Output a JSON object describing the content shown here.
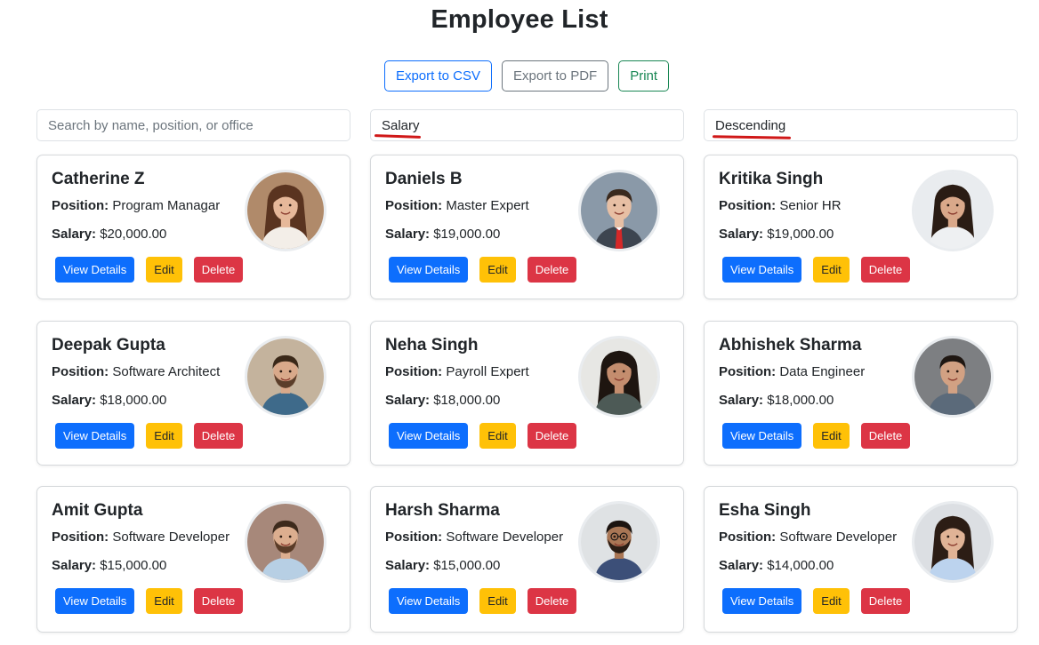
{
  "title": "Employee List",
  "export": {
    "csv_label": "Export to CSV",
    "pdf_label": "Export to PDF",
    "print_label": "Print"
  },
  "filters": {
    "search_placeholder": "Search by name, position, or office",
    "search_value": "",
    "sort_field": "Salary",
    "sort_order": "Descending"
  },
  "labels": {
    "position": "Position:",
    "salary": "Salary:",
    "view": "View Details",
    "edit": "Edit",
    "delete": "Delete"
  },
  "employees": [
    {
      "name": "Catherine Z",
      "position": "Program Managar",
      "salary": "$20,000.00",
      "avatar": "woman-long-hair"
    },
    {
      "name": "Daniels B",
      "position": "Master Expert",
      "salary": "$19,000.00",
      "avatar": "man-suit-red-tie"
    },
    {
      "name": "Kritika Singh",
      "position": "Senior HR",
      "salary": "$19,000.00",
      "avatar": "woman-office"
    },
    {
      "name": "Deepak Gupta",
      "position": "Software Architect",
      "salary": "$18,000.00",
      "avatar": "man-beard-denim"
    },
    {
      "name": "Neha Singh",
      "position": "Payroll Expert",
      "salary": "$18,000.00",
      "avatar": "woman-dark-hair"
    },
    {
      "name": "Abhishek Sharma",
      "position": "Data Engineer",
      "salary": "$18,000.00",
      "avatar": "man-jacket-phone"
    },
    {
      "name": "Amit Gupta",
      "position": "Software Developer",
      "salary": "$15,000.00",
      "avatar": "man-beard-smile"
    },
    {
      "name": "Harsh Sharma",
      "position": "Software Developer",
      "salary": "$15,000.00",
      "avatar": "man-glasses-arms-crossed"
    },
    {
      "name": "Esha Singh",
      "position": "Software Developer",
      "salary": "$14,000.00",
      "avatar": "woman-striped-shirt"
    }
  ],
  "colors": {
    "primary": "#0d6efd",
    "warning": "#ffc107",
    "danger": "#dc3545",
    "success": "#198754",
    "secondary": "#6c757d",
    "annotation": "#d01818"
  }
}
